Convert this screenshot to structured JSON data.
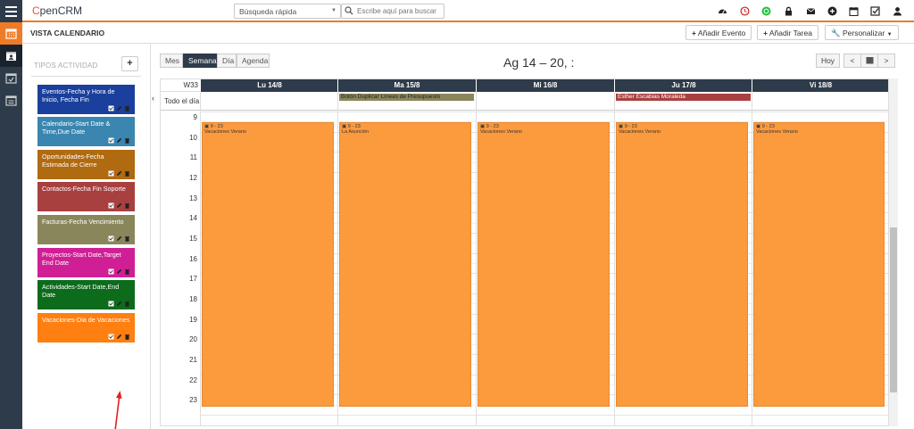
{
  "app": {
    "logo_prefix": "C",
    "logo_text": "penCRM"
  },
  "search": {
    "select_value": "Búsqueda rápida",
    "placeholder": "Escribe aquí para buscar"
  },
  "subbar": {
    "title": "VISTA CALENDARIO",
    "add_event": "Añadir Evento",
    "add_task": "Añadir Tarea",
    "customize": "Personalizar"
  },
  "panel": {
    "title": "TIPOS ACTIVIDAD",
    "add_label": "+"
  },
  "activity_types": [
    {
      "label": "Eventos-Fecha y Hora de Inicio, Fecha Fin",
      "color": "#1a3f9c"
    },
    {
      "label": "Calendario-Start Date & Time,Due Date",
      "color": "#3a86b0"
    },
    {
      "label": "Oportunidades-Fecha Estimada de Cierre",
      "color": "#b06a10"
    },
    {
      "label": "Contactos-Fecha Fin Soporte",
      "color": "#a94040"
    },
    {
      "label": "Facturas-Fecha Vencimiento",
      "color": "#8a865c"
    },
    {
      "label": "Proyectos-Start Date,Target End Date",
      "color": "#d01f95"
    },
    {
      "label": "Actividades-Start Date,End Date",
      "color": "#0d6b1c"
    },
    {
      "label": "Vacaciones-Dia de Vacaciones",
      "color": "#ff7f11"
    }
  ],
  "views": {
    "month": "Mes",
    "week": "Semana",
    "day": "Día",
    "agenda": "Agenda"
  },
  "range_title": "Ag 14 – 20, :",
  "nav": {
    "today": "Hoy",
    "prev": "<",
    "next": ">"
  },
  "calendar": {
    "week_label": "W33",
    "allday_label": "Todo el día",
    "days": [
      "Lu 14/8",
      "Ma 15/8",
      "Mi 16/8",
      "Ju 17/8",
      "Vi 18/8"
    ],
    "hours": [
      "9",
      "10",
      "11",
      "12",
      "13",
      "14",
      "15",
      "16",
      "17",
      "18",
      "19",
      "20",
      "21",
      "22",
      "23"
    ],
    "allday_events": [
      {
        "day": 1,
        "title": "Botón Duplicar Líneas de Presupuesto",
        "color": "#8a865c"
      },
      {
        "day": 3,
        "title": "Esther Escabias Moraleda",
        "color": "#a94040"
      }
    ],
    "events": [
      {
        "day": 0,
        "time": "9 - 23",
        "title": "Vacaciones Verano"
      },
      {
        "day": 1,
        "time": "9 - 23",
        "title": "La Asunción"
      },
      {
        "day": 2,
        "time": "9 - 23",
        "title": "Vacaciones Verano"
      },
      {
        "day": 3,
        "time": "9 - 23",
        "title": "Vacaciones Verano"
      },
      {
        "day": 4,
        "time": "9 - 23",
        "title": "Vacaciones Verano"
      }
    ],
    "event_color": "#fc9a3e"
  }
}
